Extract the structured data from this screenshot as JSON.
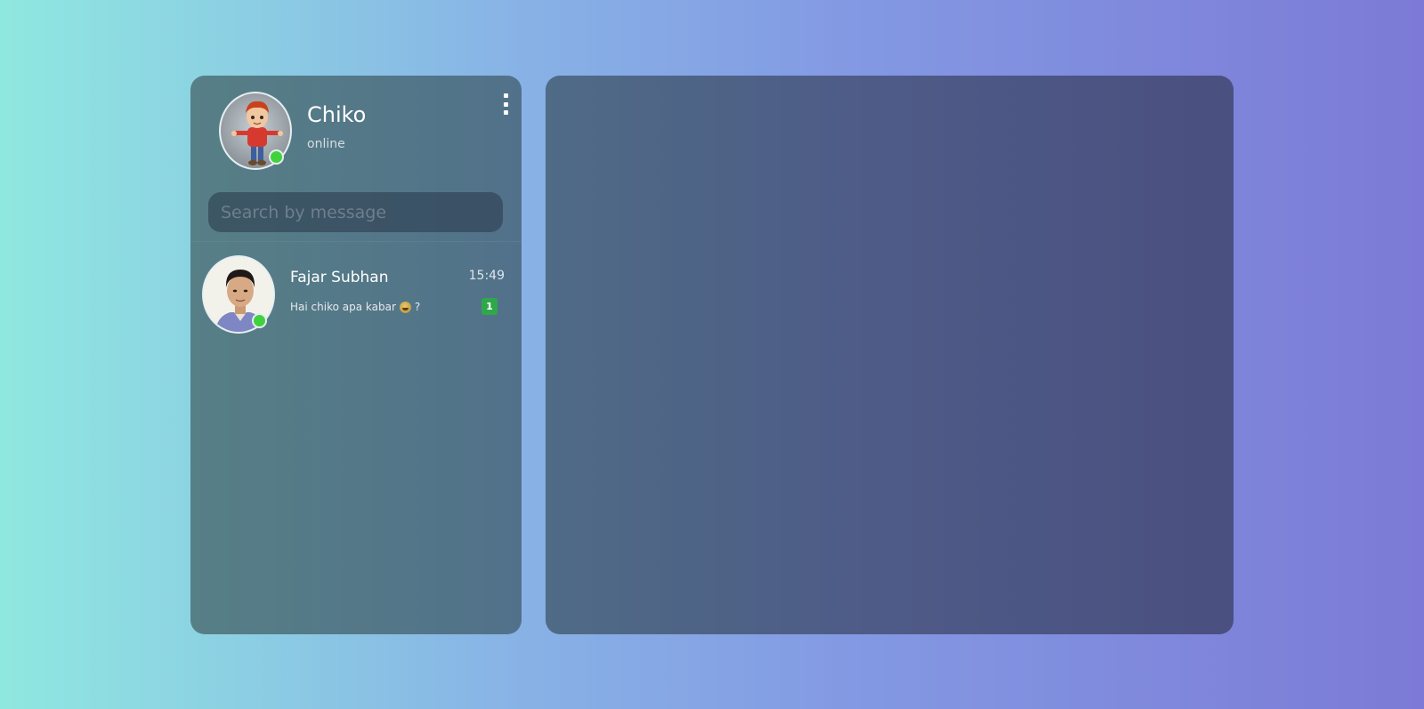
{
  "profile": {
    "name": "Chiko",
    "status": "online",
    "avatar_icon": "cartoon-boy-avatar"
  },
  "search": {
    "placeholder": "Search by message",
    "value": ""
  },
  "chats": [
    {
      "name": "Fajar Subhan",
      "time": "15:49",
      "message": "Hai chiko apa kabar",
      "emoji": "grinning-face",
      "suffix": "?",
      "unread": "1",
      "online": true
    }
  ],
  "colors": {
    "online_dot": "#3fd23c",
    "unread_badge": "#2fa84a"
  }
}
